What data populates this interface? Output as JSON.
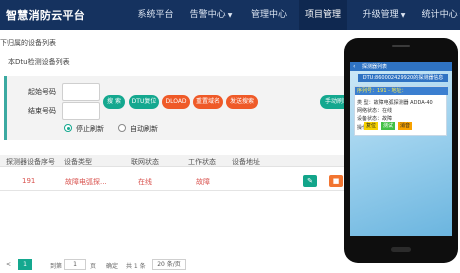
{
  "app": {
    "title": "智慧消防云平台"
  },
  "nav": {
    "items": [
      "系统平台",
      "告警中心",
      "管理中心",
      "项目管理",
      "升级管理",
      "统计中心"
    ],
    "dropdown_items": [
      1,
      4,
      5
    ],
    "active": 3
  },
  "breadcrumb": {
    "line1": "下归属的设备列表",
    "line2": "本Dtu检测设备列表"
  },
  "filter": {
    "start_label": "起始号码",
    "end_label": "结束号码",
    "start_value": "",
    "end_value": "",
    "buttons": [
      "搜 索",
      "DTU复位",
      "DLOAD",
      "重置域名",
      "发送搜索"
    ],
    "manual_refresh": "手动刷新",
    "stop_refresh": "停止刷新",
    "auto_refresh": "自动刷新"
  },
  "table": {
    "headers": [
      "探测器设备序号",
      "设备类型",
      "联网状态",
      "工作状态",
      "设备地址"
    ],
    "rows": [
      {
        "index": "191",
        "type": "故障电弧探...",
        "network": "在线",
        "work": "故障",
        "address": ""
      }
    ]
  },
  "pagination": {
    "first": "<",
    "current": "1",
    "goto_label": "到第",
    "page_value": "1",
    "page_unit": "页",
    "confirm": "确定",
    "total": "共 1 条",
    "page_size": "20 条/页"
  },
  "phone": {
    "title": "探测器列表",
    "subtitle": "DTU:860002429920的探测器信息",
    "card": {
      "header": "序列号：191 - 地址：",
      "type": "类 型：故障电弧探测器 ADDA-40",
      "network": "网络状态：在线",
      "device": "设备状态：故障",
      "ops_label": "操作："
    },
    "buttons": [
      "复位",
      "测试",
      "消音"
    ]
  },
  "colors": {
    "nav_bg": "#15325f",
    "accent": "#14a88f",
    "danger": "#ef5a28",
    "status_red": "#d9534f"
  }
}
